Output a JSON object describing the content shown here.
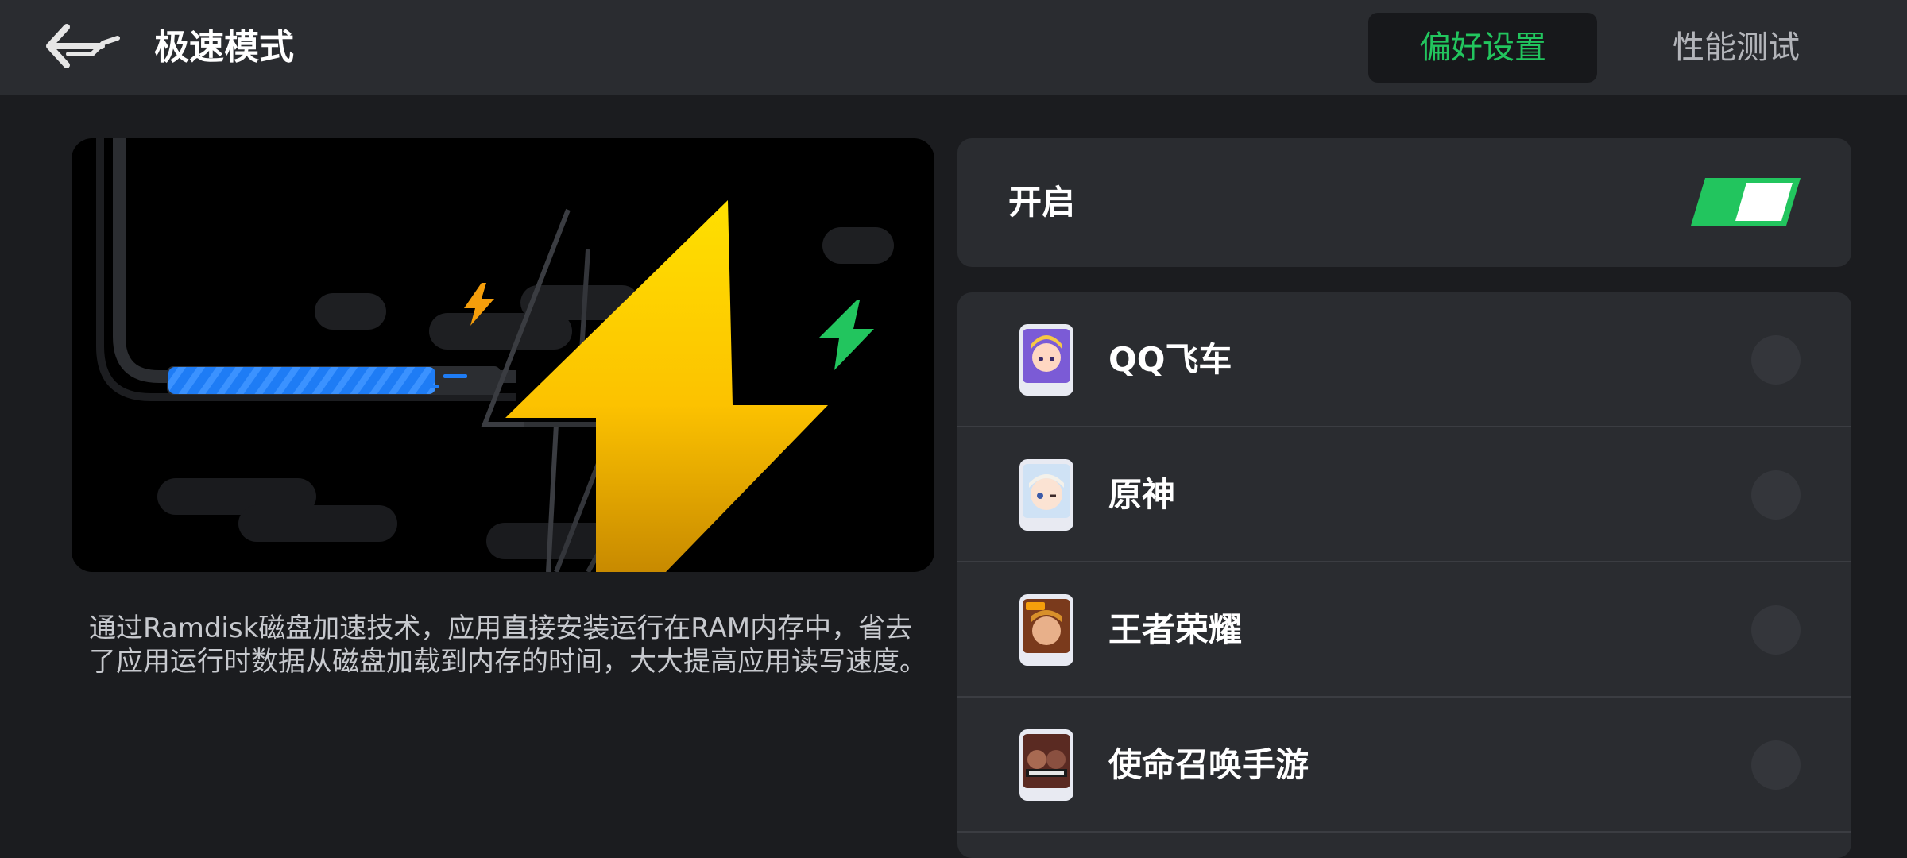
{
  "header": {
    "title": "极速模式",
    "tabs": [
      {
        "label": "偏好设置",
        "active": true
      },
      {
        "label": "性能测试",
        "active": false
      }
    ]
  },
  "hero": {
    "description": "通过Ramdisk磁盘加速技术，应用直接安装运行在RAM内存中，省去了应用运行时数据从磁盘加载到内存的时间，大大提高应用读写速度。"
  },
  "toggle": {
    "label": "开启",
    "enabled": true
  },
  "apps": [
    {
      "name": "QQ飞车",
      "selected": false
    },
    {
      "name": "原神",
      "selected": false
    },
    {
      "name": "王者荣耀",
      "selected": false
    },
    {
      "name": "使命召唤手游",
      "selected": false
    }
  ],
  "colors": {
    "accent": "#22c55e",
    "background": "#1b1c1f",
    "card": "#2a2c30",
    "bolt": "#fcd000"
  }
}
